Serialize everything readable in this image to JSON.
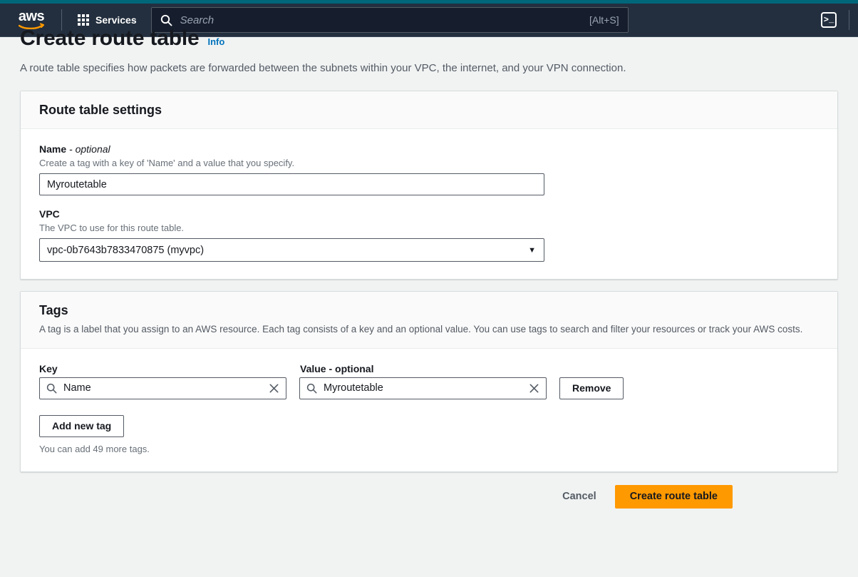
{
  "navbar": {
    "logo_text": "aws",
    "logo_icon": "aws-logo-icon",
    "services_label": "Services",
    "services_icon": "grid-menu-icon",
    "search_icon": "search-icon",
    "search_placeholder": "Search",
    "search_value": "",
    "search_shortcut": "[Alt+S]",
    "cloudshell_icon": "cloudshell-terminal-icon",
    "cloudshell_glyph": ">_",
    "colors": {
      "top_strip": "#00667A",
      "nav_background": "#232F3E",
      "search_background": "#161E2D"
    }
  },
  "header": {
    "title": "Create route table",
    "info_label": "Info",
    "description": "A route table specifies how packets are forwarded between the subnets within your VPC, the internet, and your VPN connection."
  },
  "settings_card": {
    "title": "Route table settings",
    "name_field": {
      "label": "Name",
      "optional_suffix": "- optional",
      "hint": "Create a tag with a key of 'Name' and a value that you specify.",
      "value": "Myroutetable",
      "placeholder": ""
    },
    "vpc_field": {
      "label": "VPC",
      "hint": "The VPC to use for this route table.",
      "selected": "vpc-0b7643b7833470875 (myvpc)",
      "chevron_icon": "chevron-down-icon"
    }
  },
  "tags_card": {
    "title": "Tags",
    "description": "A tag is a label that you assign to an AWS resource. Each tag consists of a key and an optional value. You can use tags to search and filter your resources or track your AWS costs.",
    "column_headers": {
      "key": "Key",
      "value": "Value",
      "value_optional_suffix": "- optional"
    },
    "rows": [
      {
        "key": "Name",
        "value": "Myroutetable",
        "key_search_icon": "search-icon",
        "value_search_icon": "search-icon",
        "key_clear_icon": "close-x-icon",
        "value_clear_icon": "close-x-icon",
        "remove_label": "Remove"
      }
    ],
    "add_tag_label": "Add new tag",
    "tag_counter": "You can add 49 more tags."
  },
  "footer": {
    "cancel_label": "Cancel",
    "submit_label": "Create route table",
    "submit_color": "#FF9900"
  }
}
